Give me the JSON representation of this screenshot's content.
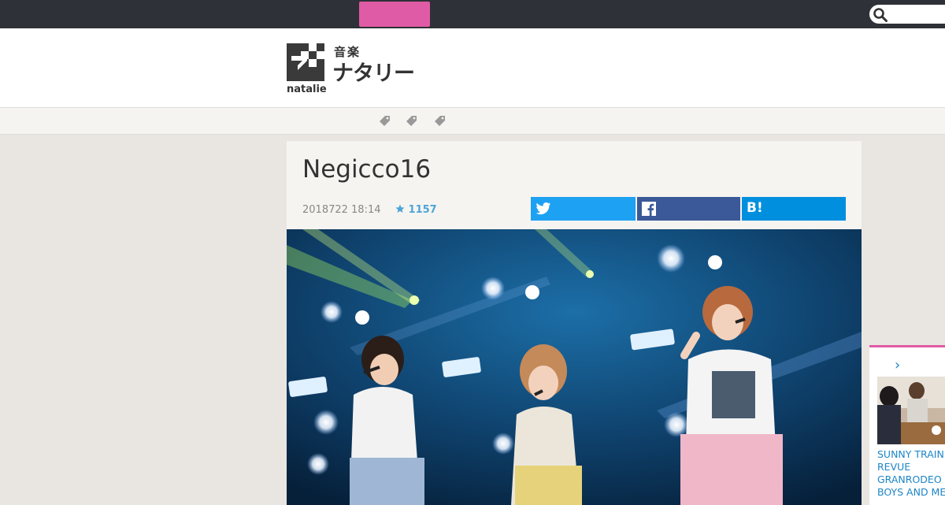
{
  "site": {
    "logo_small": "音楽",
    "logo_big": "ナタリー",
    "logo_wordmark": "natalie"
  },
  "colors": {
    "topbar": "#2e3137",
    "accent_pink": "#e05ba5",
    "twitter": "#1da1f2",
    "facebook": "#3b5998",
    "hatena": "#008fde",
    "link": "#1d85c7"
  },
  "search": {
    "icon": "search-icon"
  },
  "tags": {
    "icons": [
      "tag-icon",
      "tag-icon",
      "tag-icon"
    ]
  },
  "article": {
    "title": "Negicco16",
    "date": "2018722 18:14",
    "star_count": "1157",
    "share": {
      "twitter_icon": "twitter-icon",
      "facebook_icon": "facebook-icon",
      "hatena_label": "B!"
    }
  },
  "sidebar_card": {
    "chevron": "›",
    "lines": [
      "SUNNY TRAIN",
      "REVUE",
      "GRANRODEO",
      "BOYS AND ME"
    ]
  }
}
